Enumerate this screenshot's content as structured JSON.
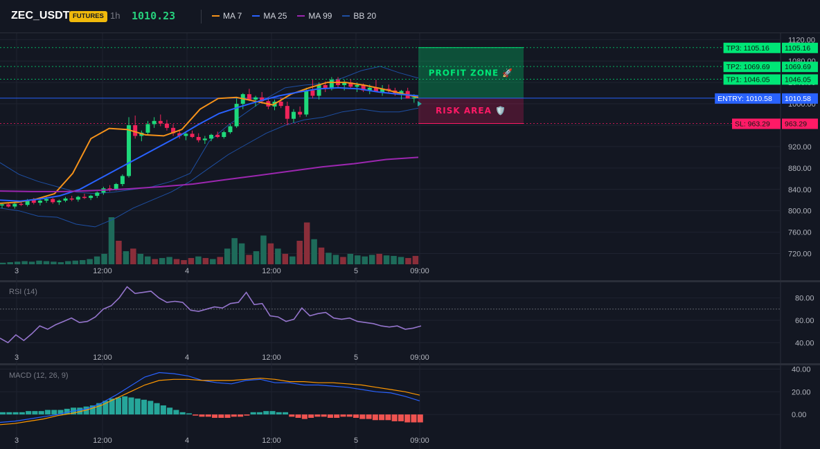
{
  "header": {
    "symbol": "ZEC_USDT",
    "market_badge": "FUTURES",
    "interval": "1h",
    "last_price": "1010.23",
    "legend": [
      {
        "name": "MA 7",
        "color": "#f7931a"
      },
      {
        "name": "MA 25",
        "color": "#2962ff"
      },
      {
        "name": "MA 99",
        "color": "#9c27b0"
      },
      {
        "name": "BB 20",
        "color": "#1e4fa3"
      }
    ]
  },
  "colors": {
    "up": "#26a69a",
    "down": "#ef5350",
    "candle_up": "#1ed97b",
    "candle_down": "#f0245a",
    "background": "#131722",
    "grid": "#1f2330"
  },
  "chart_data": [
    {
      "id": "price",
      "type": "candlestick",
      "x_tick_labels": [
        "3",
        "12:00",
        "4",
        "12:00",
        "5",
        "09:00"
      ],
      "y_ticks": [
        "1120.00",
        "1080.00",
        "1040.00",
        "1000.00",
        "960.00",
        "920.00",
        "880.00",
        "840.00",
        "800.00",
        "760.00",
        "720.00"
      ],
      "ylim": [
        700,
        1132
      ],
      "candles": [
        [
          810,
          814,
          805,
          812
        ],
        [
          812,
          815,
          806,
          808
        ],
        [
          808,
          815,
          804,
          813
        ],
        [
          813,
          818,
          809,
          811
        ],
        [
          811,
          822,
          808,
          820
        ],
        [
          820,
          824,
          812,
          815
        ],
        [
          815,
          822,
          810,
          819
        ],
        [
          819,
          826,
          815,
          822
        ],
        [
          822,
          824,
          813,
          816
        ],
        [
          816,
          821,
          811,
          819
        ],
        [
          819,
          826,
          816,
          823
        ],
        [
          823,
          828,
          818,
          821
        ],
        [
          821,
          828,
          817,
          826
        ],
        [
          826,
          832,
          822,
          824
        ],
        [
          824,
          830,
          820,
          828
        ],
        [
          828,
          836,
          824,
          834
        ],
        [
          834,
          845,
          830,
          842
        ],
        [
          842,
          848,
          836,
          840
        ],
        [
          840,
          852,
          838,
          850
        ],
        [
          850,
          868,
          846,
          865
        ],
        [
          865,
          975,
          862,
          960
        ],
        [
          960,
          978,
          935,
          940
        ],
        [
          940,
          950,
          930,
          946
        ],
        [
          946,
          968,
          943,
          962
        ],
        [
          962,
          975,
          955,
          968
        ],
        [
          968,
          980,
          958,
          963
        ],
        [
          963,
          970,
          950,
          955
        ],
        [
          955,
          962,
          940,
          945
        ],
        [
          945,
          952,
          935,
          940
        ],
        [
          940,
          948,
          932,
          944
        ],
        [
          944,
          950,
          936,
          938
        ],
        [
          938,
          945,
          928,
          932
        ],
        [
          932,
          940,
          925,
          935
        ],
        [
          935,
          944,
          930,
          942
        ],
        [
          942,
          948,
          936,
          938
        ],
        [
          938,
          950,
          935,
          947
        ],
        [
          947,
          962,
          944,
          958
        ],
        [
          958,
          1010,
          955,
          1000
        ],
        [
          1000,
          1020,
          990,
          1018
        ],
        [
          1018,
          1028,
          1005,
          1008
        ],
        [
          1008,
          1015,
          995,
          1012
        ],
        [
          1012,
          1022,
          1000,
          1005
        ],
        [
          1005,
          1012,
          990,
          995
        ],
        [
          995,
          1008,
          988,
          1004
        ],
        [
          1004,
          1012,
          992,
          996
        ],
        [
          996,
          1004,
          960,
          972
        ],
        [
          972,
          990,
          965,
          985
        ],
        [
          985,
          995,
          975,
          980
        ],
        [
          980,
          1030,
          976,
          1025
        ],
        [
          1025,
          1045,
          1010,
          1015
        ],
        [
          1015,
          1040,
          1008,
          1035
        ],
        [
          1035,
          1042,
          1022,
          1028
        ],
        [
          1028,
          1050,
          1025,
          1045
        ],
        [
          1045,
          1050,
          1030,
          1035
        ],
        [
          1035,
          1045,
          1025,
          1040
        ],
        [
          1040,
          1046,
          1028,
          1032
        ],
        [
          1032,
          1040,
          1022,
          1035
        ],
        [
          1035,
          1038,
          1022,
          1025
        ],
        [
          1025,
          1036,
          1018,
          1030
        ],
        [
          1030,
          1045,
          1025,
          1022
        ],
        [
          1022,
          1035,
          1015,
          1028
        ],
        [
          1028,
          1036,
          1020,
          1025
        ],
        [
          1025,
          1030,
          1015,
          1020
        ],
        [
          1020,
          1026,
          1008,
          1024
        ],
        [
          1024,
          1030,
          1012,
          1010
        ],
        [
          1010,
          1018,
          1002,
          1012
        ]
      ],
      "bollinger_upper": [
        890,
        868,
        855,
        845,
        835,
        832,
        835,
        840,
        845,
        855,
        870,
        930,
        960,
        985,
        1010,
        1030,
        1035,
        1038,
        1048,
        1062,
        1070,
        1058,
        1048
      ],
      "bollinger_lower": [
        805,
        800,
        790,
        788,
        775,
        770,
        785,
        805,
        820,
        835,
        855,
        880,
        905,
        925,
        945,
        960,
        970,
        975,
        985,
        990,
        985,
        985,
        992
      ],
      "series": [
        {
          "name": "MA 7",
          "color": "#f7931a",
          "values": [
            814,
            816,
            822,
            832,
            870,
            935,
            954,
            952,
            942,
            940,
            952,
            990,
            1010,
            1012,
            1005,
            998,
            1018,
            1030,
            1040,
            1040,
            1035,
            1028,
            1020,
            1012
          ]
        },
        {
          "name": "MA 25",
          "color": "#2962ff",
          "values": [
            820,
            818,
            822,
            828,
            840,
            860,
            880,
            900,
            920,
            940,
            962,
            982,
            994,
            1005,
            1015,
            1022,
            1028,
            1030,
            1028,
            1022,
            1018,
            1015
          ]
        },
        {
          "name": "MA 99",
          "color": "#9c27b0",
          "values": [
            837,
            836,
            836,
            838,
            841,
            845,
            850,
            858,
            866,
            874,
            882,
            888,
            896,
            900
          ]
        }
      ],
      "volumes": [
        3,
        4,
        5,
        6,
        5,
        7,
        6,
        5,
        4,
        6,
        7,
        8,
        10,
        15,
        20,
        90,
        45,
        25,
        30,
        20,
        15,
        10,
        12,
        14,
        10,
        8,
        12,
        15,
        12,
        10,
        14,
        30,
        50,
        40,
        18,
        25,
        55,
        40,
        30,
        20,
        15,
        45,
        80,
        48,
        32,
        22,
        18,
        14,
        20,
        17,
        15,
        18,
        20,
        17,
        16,
        14,
        12,
        16
      ],
      "volume_direction": [
        "u",
        "u",
        "u",
        "u",
        "u",
        "u",
        "u",
        "u",
        "u",
        "u",
        "u",
        "u",
        "u",
        "u",
        "u",
        "u",
        "d",
        "u",
        "d",
        "u",
        "u",
        "d",
        "u",
        "u",
        "d",
        "d",
        "d",
        "u",
        "d",
        "u",
        "d",
        "u",
        "u",
        "u",
        "d",
        "u",
        "u",
        "d",
        "u",
        "d",
        "u",
        "d",
        "d",
        "u",
        "d",
        "u",
        "u",
        "d",
        "u",
        "u",
        "u",
        "u",
        "d",
        "u",
        "u",
        "u",
        "d",
        "d"
      ],
      "price_levels": [
        {
          "label": "TP3: 1105.16",
          "price_text": "1105.16",
          "value": 1105.16,
          "color": "#00e676"
        },
        {
          "label": "TP2: 1069.69",
          "price_text": "1069.69",
          "value": 1069.69,
          "color": "#00e676"
        },
        {
          "label": "TP1: 1046.05",
          "price_text": "1046.05",
          "value": 1046.05,
          "color": "#00e676"
        },
        {
          "label": "ENTRY: 1010.58",
          "price_text": "1010.58",
          "value": 1010.58,
          "color": "#2962ff"
        },
        {
          "label": "SL: 963.29",
          "price_text": "963.29",
          "value": 963.29,
          "color": "#ff1a66"
        }
      ],
      "zones": [
        {
          "label": "PROFIT ZONE 🚀",
          "from": 1010.58,
          "to": 1105.16,
          "color": "#00e676"
        },
        {
          "label": "RISK AREA 🛡️",
          "from": 963.29,
          "to": 1010.58,
          "color": "#ff1a66"
        }
      ]
    },
    {
      "id": "rsi",
      "type": "line",
      "title": "RSI (14)",
      "y_ticks": [
        "80.00",
        "60.00",
        "40.00"
      ],
      "ylim": [
        34,
        94
      ],
      "level": 70,
      "series": [
        {
          "name": "RSI (14)",
          "color": "#9575cd",
          "values": [
            44,
            40,
            47,
            42,
            48,
            55,
            52,
            56,
            59,
            62,
            58,
            59,
            63,
            70,
            73,
            80,
            90,
            84,
            85,
            86,
            80,
            76,
            77,
            76,
            69,
            68,
            70,
            72,
            71,
            75,
            76,
            85,
            74,
            75,
            64,
            63,
            59,
            61,
            71,
            64,
            66,
            67,
            62,
            61,
            62,
            59,
            58,
            57,
            55,
            54,
            55,
            52,
            53,
            55
          ]
        }
      ],
      "x_tick_labels": [
        "3",
        "12:00",
        "4",
        "12:00",
        "5",
        "09:00"
      ]
    },
    {
      "id": "macd",
      "type": "line",
      "title": "MACD (12, 26, 9)",
      "y_ticks": [
        "40.00",
        "20.00",
        "0.00"
      ],
      "ylim": [
        -14,
        44
      ],
      "series": [
        {
          "name": "MACD",
          "color": "#2962ff",
          "values": [
            -7,
            -6,
            -4,
            -2,
            0,
            3,
            5,
            10,
            17,
            25,
            33,
            37,
            36,
            34,
            30,
            28,
            27,
            30,
            31,
            28,
            28,
            26,
            26,
            25,
            24,
            22,
            20,
            19,
            16,
            12
          ]
        },
        {
          "name": "Signal",
          "color": "#ff9800",
          "values": [
            -9,
            -8,
            -6,
            -4,
            -1,
            1,
            4,
            8,
            14,
            20,
            26,
            30,
            31,
            31,
            30,
            30,
            30,
            31,
            32,
            31,
            29,
            29,
            28,
            28,
            27,
            26,
            24,
            22,
            20,
            17
          ]
        }
      ],
      "histogram": [
        2,
        2,
        2,
        2,
        3,
        3,
        3,
        4,
        4,
        4,
        5,
        6,
        6,
        7,
        8,
        10,
        12,
        14,
        15,
        16,
        15,
        14,
        13,
        12,
        10,
        8,
        6,
        4,
        2,
        1,
        -1,
        -2,
        -2,
        -3,
        -3,
        -3,
        -2,
        -2,
        -1,
        2,
        2,
        3,
        3,
        2,
        2,
        -2,
        -3,
        -4,
        -3,
        -2,
        -2,
        -3,
        -3,
        -2,
        -2,
        -3,
        -4,
        -4,
        -5,
        -5,
        -5,
        -6,
        -6,
        -7,
        -7,
        -7
      ],
      "x_tick_labels": [
        "3",
        "12:00",
        "4",
        "12:00",
        "5",
        "09:00"
      ]
    }
  ]
}
